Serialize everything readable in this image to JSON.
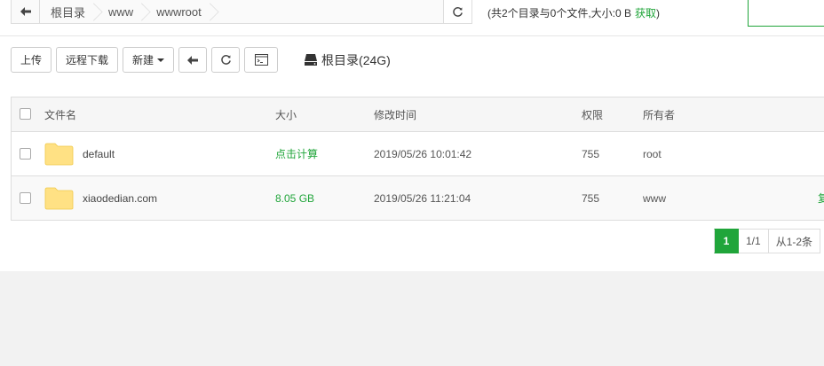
{
  "pathbar": {
    "crumbs": [
      "根目录",
      "www",
      "wwwroot"
    ]
  },
  "summary": {
    "text": "(共2个目录与0个文件,大小:0 B",
    "link": "获取",
    "close": ")"
  },
  "toolbar": {
    "upload": "上传",
    "remote_download": "远程下载",
    "new": "新建",
    "disk": "根目录(24G)"
  },
  "table": {
    "headers": {
      "name": "文件名",
      "size": "大小",
      "mtime": "修改时间",
      "perm": "权限",
      "owner": "所有者"
    },
    "rows": [
      {
        "name": "default",
        "size": "点击计算",
        "mtime": "2019/05/26 10:01:42",
        "perm": "755",
        "owner": "root",
        "op": ""
      },
      {
        "name": "xiaodedian.com",
        "size": "8.05 GB",
        "mtime": "2019/05/26 11:21:04",
        "perm": "755",
        "owner": "www",
        "op": "复"
      }
    ]
  },
  "pager": {
    "current": "1",
    "total": "1/1",
    "range": "从1-2条"
  },
  "colors": {
    "accent": "#20a53a",
    "folder": "#ffe184"
  }
}
